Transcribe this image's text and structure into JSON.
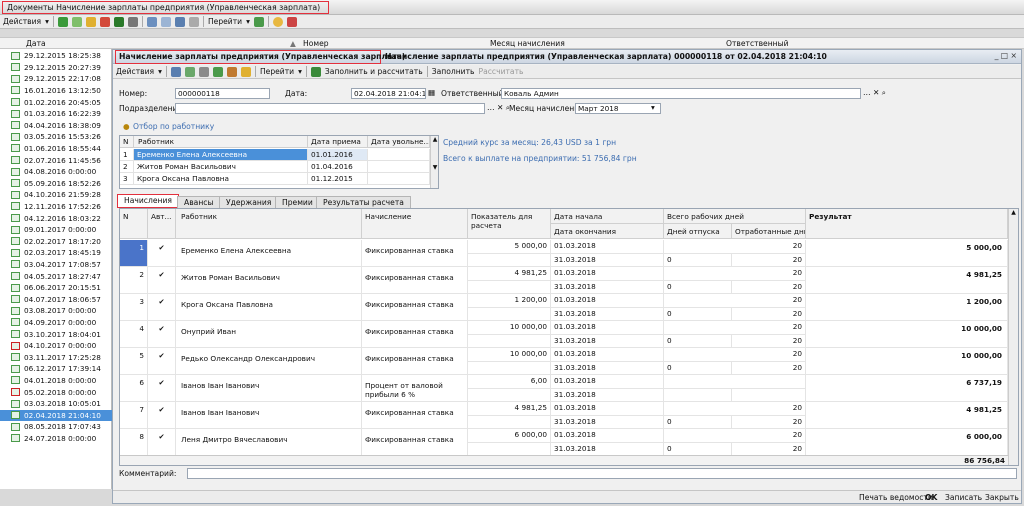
{
  "window": {
    "title": "Документы Начисление зарплаты предприятия (Управленческая зарплата)"
  },
  "main_toolbar": {
    "actions": "Действия",
    "goto": "Перейти"
  },
  "list_header": {
    "date": "Дата",
    "number": "Номер",
    "month": "Месяц начисления",
    "responsible": "Ответственный"
  },
  "list": [
    {
      "date": "29.12.2015 18:25:38"
    },
    {
      "date": "29.12.2015 20:27:39"
    },
    {
      "date": "29.12.2015 22:17:08"
    },
    {
      "date": "16.01.2016 13:12:50"
    },
    {
      "date": "01.02.2016 20:45:05"
    },
    {
      "date": "01.03.2016 16:22:39"
    },
    {
      "date": "04.04.2016 18:38:09"
    },
    {
      "date": "03.05.2016 15:53:26"
    },
    {
      "date": "01.06.2016 18:55:44"
    },
    {
      "date": "02.07.2016 11:45:56"
    },
    {
      "date": "04.08.2016 0:00:00"
    },
    {
      "date": "05.09.2016 18:52:26"
    },
    {
      "date": "04.10.2016 21:59:28"
    },
    {
      "date": "12.11.2016 17:52:26"
    },
    {
      "date": "04.12.2016 18:03:22"
    },
    {
      "date": "09.01.2017 0:00:00"
    },
    {
      "date": "02.02.2017 18:17:20"
    },
    {
      "date": "02.03.2017 18:45:19"
    },
    {
      "date": "03.04.2017 17:08:57"
    },
    {
      "date": "04.05.2017 18:27:47"
    },
    {
      "date": "06.06.2017 20:15:51"
    },
    {
      "date": "04.07.2017 18:06:57"
    },
    {
      "date": "03.08.2017 0:00:00"
    },
    {
      "date": "04.09.2017 0:00:00"
    },
    {
      "date": "03.10.2017 18:04:01"
    },
    {
      "date": "04.10.2017 0:00:00"
    },
    {
      "date": "03.11.2017 17:25:28"
    },
    {
      "date": "06.12.2017 17:39:14"
    },
    {
      "date": "04.01.2018 0:00:00"
    },
    {
      "date": "05.02.2018 0:00:00"
    },
    {
      "date": "03.03.2018 10:05:01"
    },
    {
      "date": "02.04.2018 21:04:10"
    },
    {
      "date": "08.05.2018 17:07:43"
    },
    {
      "date": "24.07.2018 0:00:00"
    }
  ],
  "doc": {
    "title_box": "Начисление зарплаты предприятия (Управленческая зарплата)",
    "title_rest": "Начисление зарплаты предприятия (Управленческая зарплата) 000000118 от 02.04.2018 21:04:10",
    "toolbar": {
      "actions": "Действия",
      "goto": "Перейти",
      "fill_calc": "Заполнить и рассчитать",
      "fill": "Заполнить",
      "calc": "Рассчитать"
    },
    "number_label": "Номер:",
    "number": "000000118",
    "date_label": "Дата:",
    "date": "02.04.2018 21:04:10",
    "resp_label": "Ответственный:",
    "resp": "Коваль Админ",
    "dept_label": "Подразделение:",
    "dept": "",
    "month_label": "Месяц начисления:",
    "month": "Март 2018",
    "filter_label": "Отбор по работнику",
    "emp_header": {
      "n": "N",
      "name": "Работник",
      "hire": "Дата приема",
      "fire": "Дата увольне..."
    },
    "employees": [
      {
        "n": "1",
        "name": "Еременко Елена Алексеевна",
        "hire": "01.01.2016"
      },
      {
        "n": "2",
        "name": "Житов Роман Васильович",
        "hire": "01.04.2016"
      },
      {
        "n": "3",
        "name": "Крога Оксана Павловна",
        "hire": "01.12.2015"
      }
    ],
    "rate_text": "Средний курс за месяц: 26,43 USD за 1 грн",
    "total_text": "Всего к выплате на предприятии: 51 756,84 грн",
    "tabs": [
      "Начисления",
      "Авансы",
      "Удержания",
      "Премии",
      "Результаты расчета"
    ],
    "acc_header": {
      "n": "N",
      "auto": "Авт...",
      "emp": "Работник",
      "acc": "Начисление",
      "ind": "Показатель для расчета",
      "start": "Дата начала",
      "end": "Дата окончания",
      "days": "Всего рабочих дней",
      "vac": "Дней отпуска",
      "worked": "Отработанные дни",
      "result": "Результат"
    },
    "rows": [
      {
        "n": "1",
        "check": "✔",
        "emp": "Еременко Елена Алексеевна",
        "acc": "Фиксированная ставка",
        "ind": "5 000,00",
        "start": "01.03.2018",
        "end": "31.03.2018",
        "vac": "0",
        "days": "20",
        "worked": "20",
        "result": "5 000,00"
      },
      {
        "n": "2",
        "check": "✔",
        "emp": "Житов Роман Васильович",
        "acc": "Фиксированная ставка",
        "ind": "4 981,25",
        "start": "01.03.2018",
        "end": "31.03.2018",
        "vac": "0",
        "days": "20",
        "worked": "20",
        "result": "4 981,25"
      },
      {
        "n": "3",
        "check": "✔",
        "emp": "Крога Оксана Павловна",
        "acc": "Фиксированная ставка",
        "ind": "1 200,00",
        "start": "01.03.2018",
        "end": "31.03.2018",
        "vac": "0",
        "days": "20",
        "worked": "20",
        "result": "1 200,00"
      },
      {
        "n": "4",
        "check": "✔",
        "emp": "Онуприй Иван",
        "acc": "Фиксированная ставка",
        "ind": "10 000,00",
        "start": "01.03.2018",
        "end": "31.03.2018",
        "vac": "0",
        "days": "20",
        "worked": "20",
        "result": "10 000,00"
      },
      {
        "n": "5",
        "check": "✔",
        "emp": "Редько Олександр Олександрович",
        "acc": "Фиксированная ставка",
        "ind": "10 000,00",
        "start": "01.03.2018",
        "end": "31.03.2018",
        "vac": "0",
        "days": "20",
        "worked": "20",
        "result": "10 000,00"
      },
      {
        "n": "6",
        "check": "✔",
        "emp": "Іванов Іван Іванович",
        "acc": "Процент от валовой прибыли 6 %",
        "ind": "6,00",
        "start": "01.03.2018",
        "end": "31.03.2018",
        "vac": "",
        "days": "",
        "worked": "",
        "result": "6 737,19"
      },
      {
        "n": "7",
        "check": "✔",
        "emp": "Іванов Іван Іванович",
        "acc": "Фиксированная ставка",
        "ind": "4 981,25",
        "start": "01.03.2018",
        "end": "31.03.2018",
        "vac": "0",
        "days": "20",
        "worked": "20",
        "result": "4 981,25"
      },
      {
        "n": "8",
        "check": "✔",
        "emp": "Леня Дмитро Вячеславович",
        "acc": "Фиксированная ставка",
        "ind": "6 000,00",
        "start": "01.03.2018",
        "end": "31.03.2018",
        "vac": "0",
        "days": "20",
        "worked": "20",
        "result": "6 000,00"
      }
    ],
    "grand_total": "86 756,84",
    "comment_label": "Комментарий:",
    "footer": {
      "print": "Печать ведомости",
      "ok": "OK",
      "save": "Записать",
      "close": "Закрыть"
    }
  }
}
